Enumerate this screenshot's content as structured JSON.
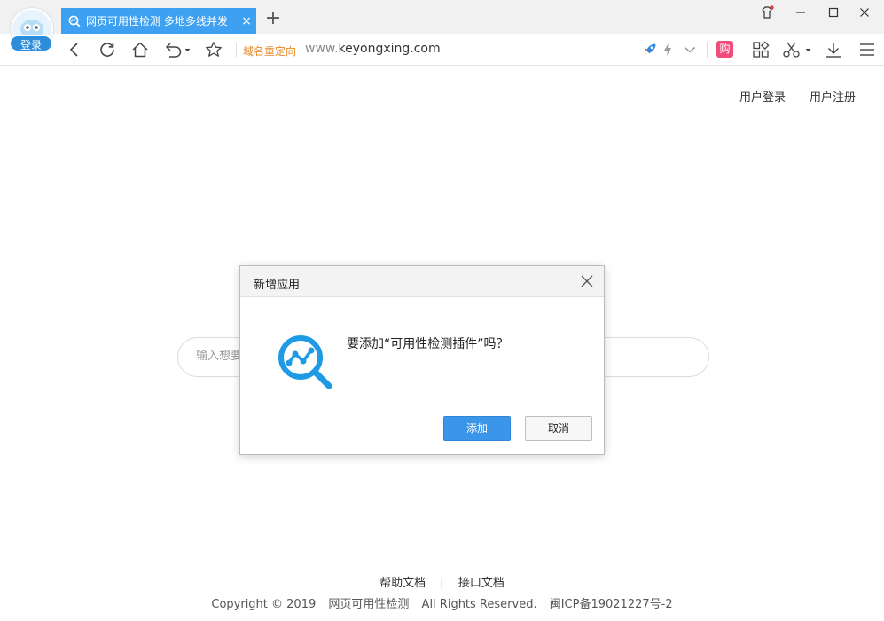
{
  "browser": {
    "login_badge": "登录",
    "tab": {
      "title": "网页可用性检测 多地多线并发",
      "close": "×"
    },
    "new_tab": "+",
    "address": {
      "redirect_label": "域名重定向",
      "url_prefix": "www.",
      "url_domain": "keyongxing.com"
    },
    "buy_badge": "购",
    "accent_color": "#3da0f0"
  },
  "page": {
    "nav": {
      "login": "用户登录",
      "register": "用户注册"
    },
    "search": {
      "placeholder": "输入想要检测的网址"
    },
    "footer": {
      "help": "帮助文档",
      "separator": "|",
      "api": "接口文档",
      "copyright": "Copyright © 2019",
      "site_name": "网页可用性检测",
      "rights": "All Rights Reserved.",
      "icp": "闽ICP备19021227号-2"
    }
  },
  "dialog": {
    "title": "新增应用",
    "message": "要添加“可用性检测插件”吗？",
    "add_button": "添加",
    "cancel_button": "取消",
    "logo_icon": "magnifier-chart-icon",
    "logo_color": "#1e9be4"
  }
}
